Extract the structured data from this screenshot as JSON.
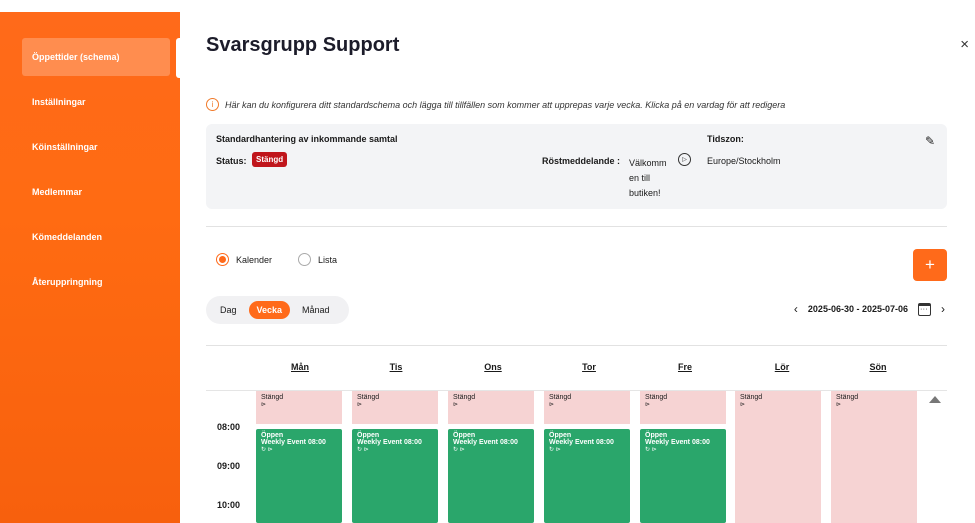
{
  "sidebar": {
    "items": [
      {
        "label": "Öppettider (schema)",
        "active": true
      },
      {
        "label": "Inställningar"
      },
      {
        "label": "Köinställningar"
      },
      {
        "label": "Medlemmar"
      },
      {
        "label": "Kömeddelanden"
      },
      {
        "label": "Återuppringning"
      }
    ]
  },
  "header": {
    "title": "Svarsgrupp Support",
    "close_label": "×"
  },
  "info": {
    "icon": "i",
    "text": "Här kan du konfigurera ditt standardschema och lägga till tillfällen som kommer att upprepas varje vecka. Klicka på en vardag för att redigera"
  },
  "card": {
    "heading": "Standardhantering av inkommande samtal",
    "status_label": "Status:",
    "status_value": "Stängd",
    "voice_label": "Röstmeddelande :",
    "voice_value": "Välkomm\nen till\nbutiken!",
    "tz_label": "Tidszon:",
    "tz_value": "Europe/Stockholm"
  },
  "view_mode": {
    "calendar": "Kalender",
    "list": "Lista",
    "selected": "calendar"
  },
  "add_label": "+",
  "period": {
    "day": "Dag",
    "week": "Vecka",
    "month": "Månad",
    "selected": "week"
  },
  "date_range": "2025-06-30 - 2025-07-06",
  "days": [
    "Mån",
    "Tis",
    "Ons",
    "Tor",
    "Fre",
    "Lör",
    "Sön"
  ],
  "times": [
    "08:00",
    "09:00",
    "10:00"
  ],
  "events": {
    "closed_label": "Stängd",
    "open_label": "Öppen",
    "open_title": "Weekly Event 08:00"
  },
  "colors": {
    "accent": "#ff6a1a",
    "open": "#2aa66b",
    "closed": "#f6d3d3",
    "status": "#c0161c"
  }
}
